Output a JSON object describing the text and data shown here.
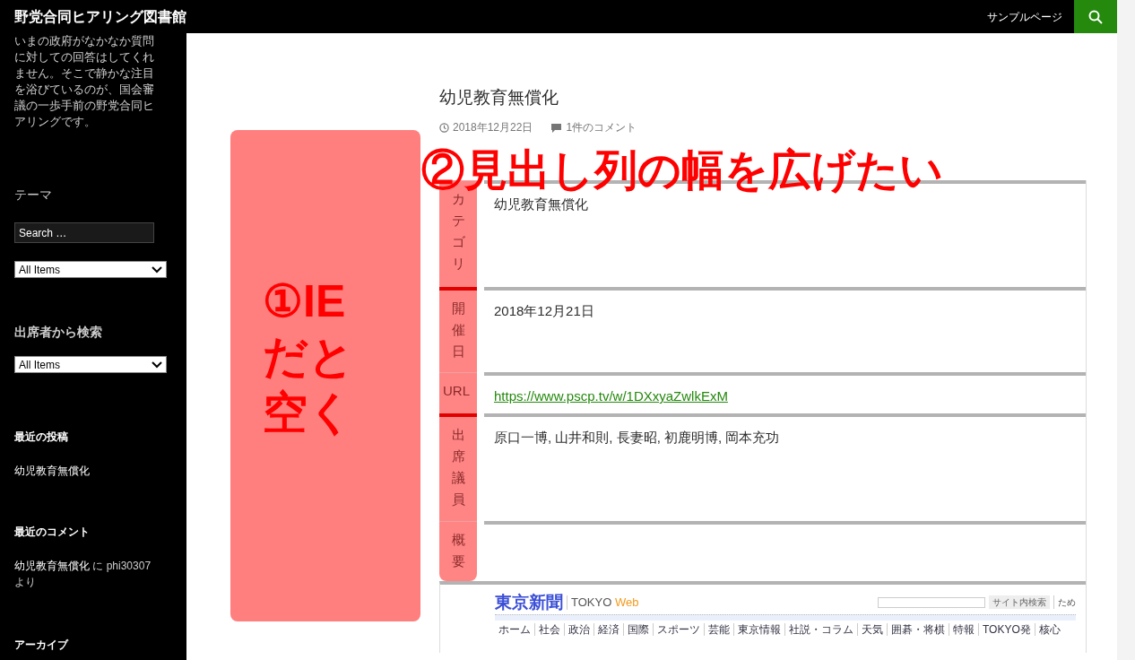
{
  "site": {
    "title": "野党合同ヒアリング図書館",
    "nav": [
      {
        "label": "サンプルページ"
      }
    ]
  },
  "sidebar": {
    "description": "いまの政府がなかなか質問に対しての回答はしてくれません。そこで静かな注目を浴びているのが、国会審議の一歩手前の野党合同ヒアリングです。",
    "theme": {
      "title": "テーマ",
      "search_placeholder": "Search …",
      "select": "All Items"
    },
    "attendees": {
      "title": "出席者から検索",
      "select": "All Items"
    },
    "recent_posts": {
      "title": "最近の投稿",
      "items": [
        "幼児教育無償化"
      ]
    },
    "recent_comments": {
      "title": "最近のコメント",
      "items": [
        {
          "post": "幼児教育無償化",
          "joiner": "に",
          "author": "phi30307",
          "tail": "より"
        }
      ]
    },
    "archive": {
      "title": "アーカイブ"
    }
  },
  "post": {
    "title": "幼児教育無償化",
    "date": "2018年12月22日",
    "comments": "1件のコメント",
    "rows": [
      {
        "header": "カテゴリ",
        "kind": "text",
        "value": "幼児教育無償化",
        "marked": false
      },
      {
        "header": "開催日",
        "kind": "text",
        "value": "2018年12月21日",
        "marked": true
      },
      {
        "header": "URL",
        "kind": "link",
        "value": "https://www.pscp.tv/w/1DXxyaZwlkExM",
        "marked": false
      },
      {
        "header": "出席議員",
        "kind": "text",
        "value": "原口一博, 山井和則, 長妻昭, 初鹿明博, 岡本充功",
        "marked": true
      },
      {
        "header": "概要",
        "kind": "empty",
        "marked": false
      }
    ]
  },
  "embedded_site": {
    "logo": "東京新聞",
    "brand": "TOKYO",
    "brand_accent": "Web",
    "search_button": "サイト内検索",
    "extra": "ため",
    "nav": [
      "ホーム",
      "社会",
      "政治",
      "経済",
      "国際",
      "スポーツ",
      "芸能",
      "東京情報",
      "社説・コラム",
      "天気",
      "囲碁・将棋",
      "特報",
      "TOKYO発",
      "核心"
    ]
  },
  "annotations": {
    "left": [
      "①IE",
      "だと",
      "空く"
    ],
    "top": "②見出し列の幅を広げたい"
  }
}
